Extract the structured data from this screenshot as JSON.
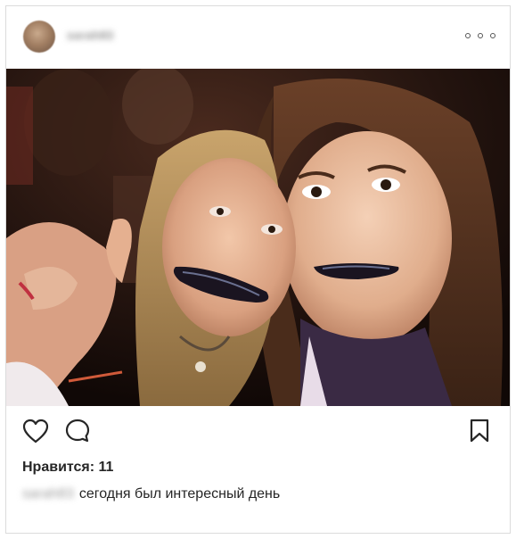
{
  "post": {
    "username": "sarah83",
    "image_alt": "Две девушки с фильтром, искажающим рот",
    "likes_label": "Нравится: 11",
    "caption_user": "sarah83",
    "caption_text": "сегодня был интересный день"
  },
  "icons": {
    "more": "more-horizontal-icon",
    "like": "heart-icon",
    "comment": "comment-icon",
    "save": "bookmark-icon"
  }
}
